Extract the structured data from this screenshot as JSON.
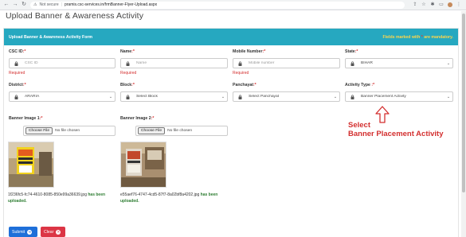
{
  "browser": {
    "security_label": "Not secure",
    "url": "pramis.csc-services.in/frmBanner-Flyer-Upload.aspx"
  },
  "page": {
    "title": "Upload Banner & Awareness Activity"
  },
  "card": {
    "title": "Upload Banner & Awareness Activity Form",
    "mandatory_prefix": "Fields marked with",
    "mandatory_star": "*",
    "mandatory_suffix": "are mandatory."
  },
  "fields": {
    "csc_id": {
      "label": "CSC ID",
      "star": ":*",
      "placeholder": "CSC ID",
      "error": "Required"
    },
    "name": {
      "label": "Name",
      "star": ":*",
      "placeholder": "Name",
      "error": "Required"
    },
    "mobile": {
      "label": "Mobile Number",
      "star": ":*",
      "placeholder": "Mobile number",
      "error": "Required"
    },
    "state": {
      "label": "State",
      "star": ":*",
      "value": "BIHAR"
    },
    "district": {
      "label": "District",
      "star": ":*",
      "value": "ARARIA"
    },
    "block": {
      "label": "Block",
      "star": ":*",
      "value": "Select Block"
    },
    "panchayat": {
      "label": "Panchayat",
      "star": ":*",
      "value": "Select Panchayat"
    },
    "activity_type": {
      "label": "Activity Type",
      "star": " :*",
      "value": "Banner Placement Activity"
    },
    "banner1": {
      "label": "Banner Image 1",
      "star": ":*",
      "button": "Choose File",
      "status": "No file chosen",
      "uploaded_file": "1f236fc5-fc74-4610-8085-850e99a36639.jpg",
      "uploaded_msg": "has been uploaded."
    },
    "banner2": {
      "label": "Banner Image 2",
      "star": ":*",
      "button": "Choose File",
      "status": "No file chosen",
      "uploaded_file": "e55aef76-4747-4cd5-87f7-8a02bf8a4202.jpg",
      "uploaded_msg": "has been uploaded."
    }
  },
  "annotation": {
    "line1": "Select",
    "line2": "Banner Placement Activity"
  },
  "actions": {
    "submit": "Submit",
    "clear": "Clear"
  },
  "colors": {
    "header_bg": "#26a8c0",
    "required_red": "#d32f2f",
    "submit_blue": "#1e6fd9",
    "clear_red": "#dc3545"
  }
}
